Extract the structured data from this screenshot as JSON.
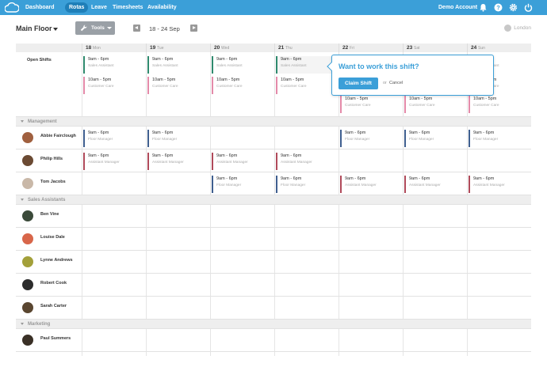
{
  "nav": {
    "items": [
      {
        "label": "Dashboard",
        "active": false
      },
      {
        "label": "Rotas",
        "active": true
      },
      {
        "label": "Leave",
        "active": false
      },
      {
        "label": "Timesheets",
        "active": false
      },
      {
        "label": "Availability",
        "active": false
      }
    ],
    "account": "Demo Account",
    "icons": [
      "bell-icon",
      "help-icon",
      "gear-icon",
      "power-icon"
    ]
  },
  "toolbar": {
    "title": "Main Floor",
    "tools_label": "Tools",
    "week_range": "18 - 24 Sep",
    "location": "London"
  },
  "days": [
    {
      "num": "18",
      "name": "Mon"
    },
    {
      "num": "19",
      "name": "Tue"
    },
    {
      "num": "20",
      "name": "Wed"
    },
    {
      "num": "21",
      "name": "Thu"
    },
    {
      "num": "22",
      "name": "Fri"
    },
    {
      "num": "23",
      "name": "Sat"
    },
    {
      "num": "24",
      "name": "Sun"
    }
  ],
  "open_shifts_label": "Open Shifts",
  "sections": {
    "management": "Management",
    "sales": "Sales Assistants",
    "marketing": "Marketing"
  },
  "people": {
    "abbie": "Abbie Fairclough",
    "philip": "Philip Hills",
    "tom": "Tom Jacobs",
    "ben": "Ben Vine",
    "louise": "Louise Dale",
    "lynne": "Lynne Andrews",
    "robert": "Robert Cook",
    "sarah": "Sarah Carter",
    "paul": "Paul Summers"
  },
  "shift_texts": {
    "t_9_6": "9am - 6pm",
    "t_10_5": "10am - 5pm",
    "r_sales": "Sales Assistant",
    "r_care": "Customer Care",
    "r_floor": "Floor Manager",
    "r_asst": "Assistant Manager"
  },
  "popover": {
    "question": "Want to work this shift?",
    "claim": "Claim Shift",
    "or": "or",
    "cancel": "Cancel"
  },
  "colors": {
    "brand": "#3b9fd8",
    "sales_bar": "#2f8a6e",
    "care_bar": "#e48aa9",
    "floor_bar": "#3f5f8f",
    "asst_bar": "#b04a5a"
  }
}
